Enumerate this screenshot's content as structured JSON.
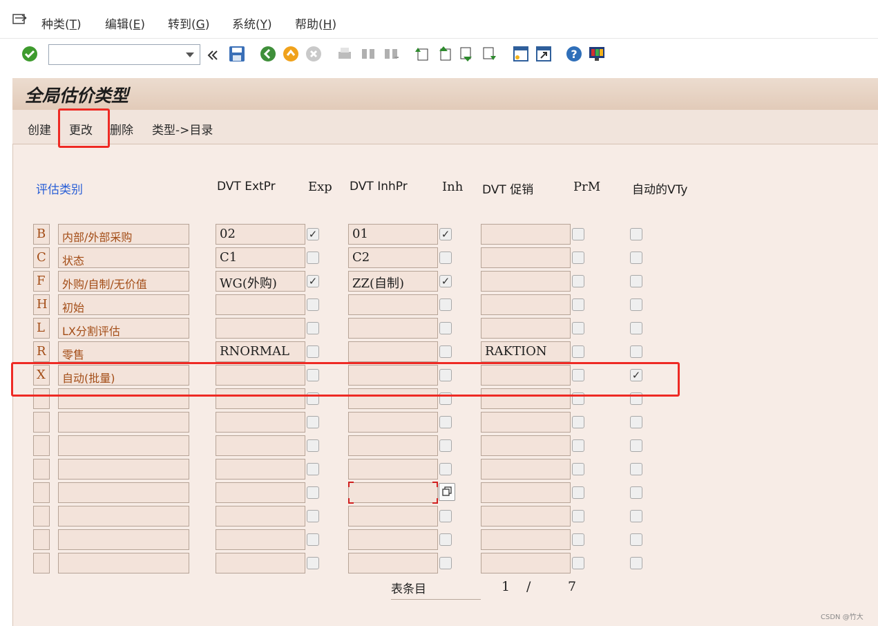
{
  "menu": [
    {
      "text": "种类(",
      "key": "T",
      "end": ")"
    },
    {
      "text": "编辑(",
      "key": "E",
      "end": ")"
    },
    {
      "text": "转到(",
      "key": "G",
      "end": ")"
    },
    {
      "text": "系统(",
      "key": "Y",
      "end": ")"
    },
    {
      "text": "帮助(",
      "key": "H",
      "end": ")"
    }
  ],
  "title": "全局估价类型",
  "actions": {
    "create": "创建",
    "change": "更改",
    "delete": "删除",
    "type_dir": "类型->目录"
  },
  "headers": {
    "category": "评估类别",
    "dvt_ext": "DVT ExtPr",
    "exp": "Exp",
    "dvt_inh": "DVT InhPr",
    "inh": "Inh",
    "dvt_promo": "DVT 促销",
    "prm": "PrM",
    "auto": "自动的VTy"
  },
  "rows": [
    {
      "code": "B",
      "desc": "内部/外部采购",
      "ext": "02",
      "exp": true,
      "inh_val": "01",
      "inh": true,
      "promo": "",
      "prm": false,
      "auto": false
    },
    {
      "code": "C",
      "desc": "状态",
      "ext": "C1",
      "exp": false,
      "inh_val": "C2",
      "inh": false,
      "promo": "",
      "prm": false,
      "auto": false
    },
    {
      "code": "F",
      "desc": "外购/自制/无价值",
      "ext": "WG(外购)",
      "exp": true,
      "inh_val": "ZZ(自制)",
      "inh": true,
      "promo": "",
      "prm": false,
      "auto": false
    },
    {
      "code": "H",
      "desc": "初始",
      "ext": "",
      "exp": false,
      "inh_val": "",
      "inh": false,
      "promo": "",
      "prm": false,
      "auto": false
    },
    {
      "code": "L",
      "desc": "LX分割评估",
      "ext": "",
      "exp": false,
      "inh_val": "",
      "inh": false,
      "promo": "",
      "prm": false,
      "auto": false
    },
    {
      "code": "R",
      "desc": "零售",
      "ext": "RNORMAL",
      "exp": false,
      "inh_val": "",
      "inh": false,
      "promo": "RAKTION",
      "prm": false,
      "auto": false
    },
    {
      "code": "X",
      "desc": "自动(批量)",
      "ext": "",
      "exp": false,
      "inh_val": "",
      "inh": false,
      "promo": "",
      "prm": false,
      "auto": true
    },
    {
      "code": "",
      "desc": "",
      "ext": "",
      "exp": false,
      "inh_val": "",
      "inh": false,
      "promo": "",
      "prm": false,
      "auto": false
    },
    {
      "code": "",
      "desc": "",
      "ext": "",
      "exp": false,
      "inh_val": "",
      "inh": false,
      "promo": "",
      "prm": false,
      "auto": false
    },
    {
      "code": "",
      "desc": "",
      "ext": "",
      "exp": false,
      "inh_val": "",
      "inh": false,
      "promo": "",
      "prm": false,
      "auto": false
    },
    {
      "code": "",
      "desc": "",
      "ext": "",
      "exp": false,
      "inh_val": "",
      "inh": false,
      "promo": "",
      "prm": false,
      "auto": false
    },
    {
      "code": "",
      "desc": "",
      "ext": "",
      "exp": false,
      "inh_val": "",
      "inh": false,
      "promo": "",
      "prm": false,
      "auto": false
    },
    {
      "code": "",
      "desc": "",
      "ext": "",
      "exp": false,
      "inh_val": "",
      "inh": false,
      "promo": "",
      "prm": false,
      "auto": false
    },
    {
      "code": "",
      "desc": "",
      "ext": "",
      "exp": false,
      "inh_val": "",
      "inh": false,
      "promo": "",
      "prm": false,
      "auto": false
    },
    {
      "code": "",
      "desc": "",
      "ext": "",
      "exp": false,
      "inh_val": "",
      "inh": false,
      "promo": "",
      "prm": false,
      "auto": false
    }
  ],
  "footer": {
    "label": "表条目",
    "current": "1",
    "sep": "/",
    "total": "7"
  },
  "watermark": "CSDN @竹大",
  "colors": {
    "highlight": "#ee2a24",
    "panel": "#f7ece6",
    "field_text": "#a34d17",
    "header_blue": "#2a5fd6"
  }
}
